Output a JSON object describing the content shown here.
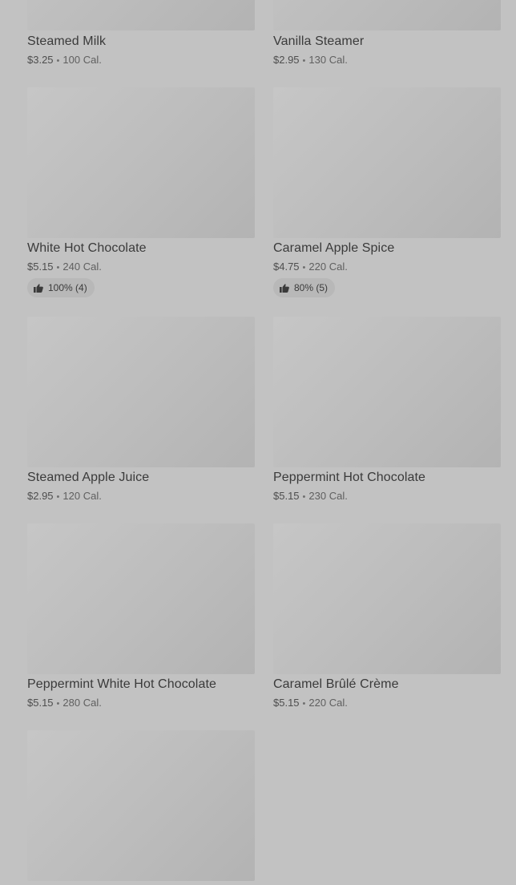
{
  "menu_items": [
    {
      "name": "Steamed Milk",
      "price": "$3.25",
      "separator": "•",
      "calories": "100 Cal."
    },
    {
      "name": "Vanilla Steamer",
      "price": "$2.95",
      "separator": "•",
      "calories": "130 Cal."
    },
    {
      "name": "White Hot Chocolate",
      "price": "$5.15",
      "separator": "•",
      "calories": "240 Cal.",
      "rating": "100% (4)"
    },
    {
      "name": "Caramel Apple Spice",
      "price": "$4.75",
      "separator": "•",
      "calories": "220 Cal.",
      "rating": "80% (5)"
    },
    {
      "name": "Steamed Apple Juice",
      "price": "$2.95",
      "separator": "•",
      "calories": "120 Cal."
    },
    {
      "name": "Peppermint Hot Chocolate",
      "price": "$5.15",
      "separator": "•",
      "calories": "230 Cal."
    },
    {
      "name": "Peppermint White Hot Chocolate",
      "price": "$5.15",
      "separator": "•",
      "calories": "280 Cal."
    },
    {
      "name": "Caramel Brûlé Crème",
      "price": "$5.15",
      "separator": "•",
      "calories": "220 Cal."
    },
    {
      "name": "",
      "price": "",
      "separator": "",
      "calories": ""
    }
  ],
  "icons": {
    "rating": "thumbs-up-icon"
  },
  "colors": {
    "overlay_background": "#c2c2c2",
    "image_placeholder": "#bcbcbc",
    "rating_pill": "#b8b8b8",
    "text_primary": "#3a3a3a"
  }
}
